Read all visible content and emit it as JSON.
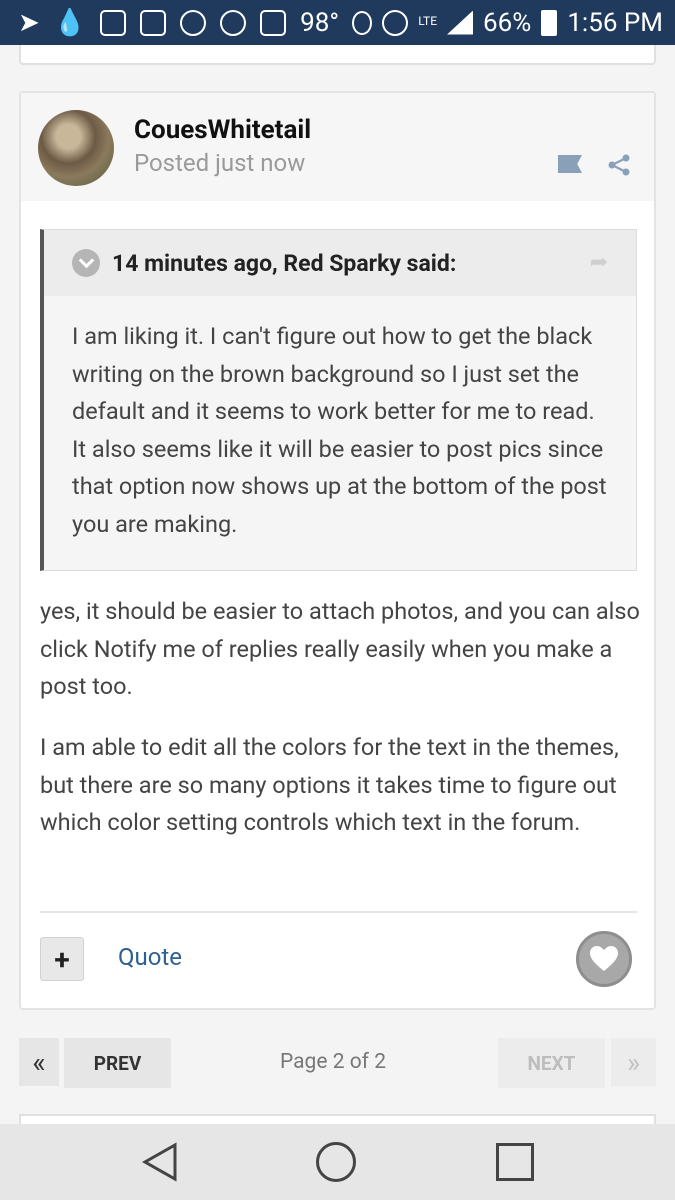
{
  "status_bar": {
    "temperature": "98°",
    "network": "LTE",
    "battery": "66%",
    "time": "1:56 PM"
  },
  "post": {
    "author": "CouesWhitetail",
    "posted": "Posted just now",
    "quote": {
      "citation": "14 minutes ago, Red Sparky said:",
      "body": "I am liking it. I can't figure out how to get the black writing on the brown background so I just set the default and it seems to work better for me to read. It also seems like it will be easier to post pics since that option now shows up at the bottom of the post you are making."
    },
    "paragraphs": [
      "yes, it should be easier to attach photos, and you can also click Notify me of replies really easily when you make a post too.",
      "I am able to edit all the colors for the text in the themes, but there are so many options it takes time to figure out which color setting controls which text in the forum."
    ],
    "actions": {
      "plus": "+",
      "quote": "Quote"
    }
  },
  "pagination": {
    "first": "«",
    "prev": "PREV",
    "label": "Page 2 of 2",
    "next": "NEXT",
    "last": "»"
  },
  "colors": {
    "status_bar": "#1f3a5c",
    "link": "#2f5f93",
    "quote_border": "#555555"
  }
}
